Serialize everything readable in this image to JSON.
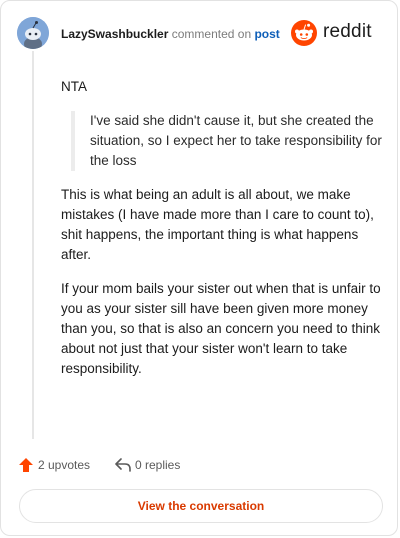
{
  "header": {
    "username": "LazySwashbuckler",
    "action_text": "commented on",
    "target_link": "post",
    "brand_name": "reddit",
    "brand_color": "#ff4500"
  },
  "comment": {
    "paragraphs_before_quote": [
      "NTA"
    ],
    "quote": "I've said she didn't cause it, but she created the situation, so I expect her to take responsibility for the loss",
    "paragraphs_after_quote": [
      "This is what being an adult is all about, we make mistakes (I have made more than I care to count to), shit happens, the important thing is what happens after.",
      "If your mom bails your sister out when that is unfair to you as your sister sill have been given more money than you, so that is also an concern you need to think about not just that your sister won't learn to take responsibility."
    ]
  },
  "footer": {
    "upvotes_label": "2 upvotes",
    "replies_label": "0 replies",
    "upvote_icon": "upvote-arrow-icon",
    "reply_icon": "reply-arrow-icon"
  },
  "cta": {
    "label": "View the conversation",
    "color": "#d93a00"
  }
}
